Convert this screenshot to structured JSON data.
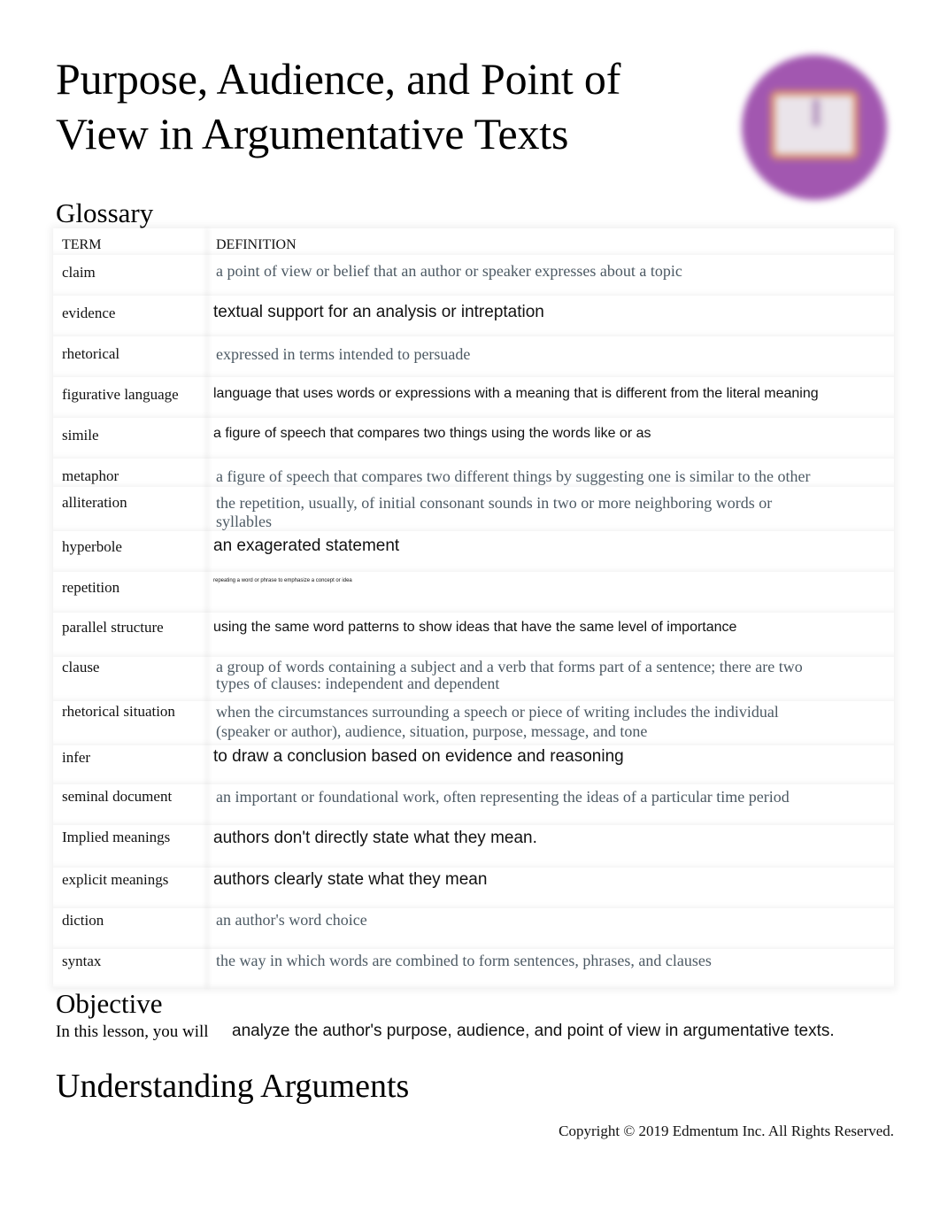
{
  "document": {
    "title": "Purpose, Audience, and Point of View in Argumentative Texts",
    "logo_icon": "book-icon",
    "brand_color": "#a257b0"
  },
  "glossary": {
    "heading": "Glossary",
    "columns": [
      "TERM",
      "DEFINITION"
    ],
    "rows": [
      {
        "term": "claim",
        "definition": "a point of view or belief that an author or speaker expresses about a topic"
      },
      {
        "term": "evidence",
        "definition": "textual support for an analysis or intreptation"
      },
      {
        "term": "rhetorical",
        "definition": "expressed in terms intended to persuade"
      },
      {
        "term": "figurative language",
        "definition": "language that uses words or expressions with a meaning that is different from the literal meaning"
      },
      {
        "term": "simile",
        "definition": "a figure of speech that compares two things using the words like or as"
      },
      {
        "term": "metaphor",
        "definition": "a figure of speech that compares two different things by suggesting one is similar to the other"
      },
      {
        "term": "alliteration",
        "definition": "the repetition, usually, of initial consonant sounds in two or more neighboring words or syllables"
      },
      {
        "term": "hyperbole",
        "definition": "an exagerated statement"
      },
      {
        "term": "repetition",
        "definition": "repeating a word or phrase to emphasize a concept or idea"
      },
      {
        "term": "parallel structure",
        "definition": "using the same word patterns to show ideas that have the same level of importance"
      },
      {
        "term": "clause",
        "definition": "a group of words containing a subject and a verb that forms part of a sentence; there are two types of clauses: independent and dependent"
      },
      {
        "term": "rhetorical situation",
        "definition": "when the circumstances surrounding a speech or piece of writing includes the individual (speaker or author), audience, situation, purpose, message, and tone"
      },
      {
        "term": "infer",
        "definition": "to draw a conclusion based on evidence and reasoning"
      },
      {
        "term": "seminal document",
        "definition": "an important or foundational work, often representing the ideas of a particular time period"
      },
      {
        "term": "Implied meanings",
        "definition": "authors don't directly state what they mean."
      },
      {
        "term": "explicit meanings",
        "definition": "authors clearly state what they mean"
      },
      {
        "term": "diction",
        "definition": "an author's word choice"
      },
      {
        "term": "syntax",
        "definition": "the way in which words are combined to form sentences, phrases, and clauses"
      }
    ]
  },
  "objective": {
    "heading": "Objective",
    "lead": "In this lesson, you will",
    "text": "analyze the author's purpose, audience, and point of view in argumentative texts."
  },
  "understanding": {
    "heading": "Understanding Arguments"
  },
  "footer": {
    "copyright": "Copyright © 2019 Edmentum Inc. All Rights Reserved."
  }
}
